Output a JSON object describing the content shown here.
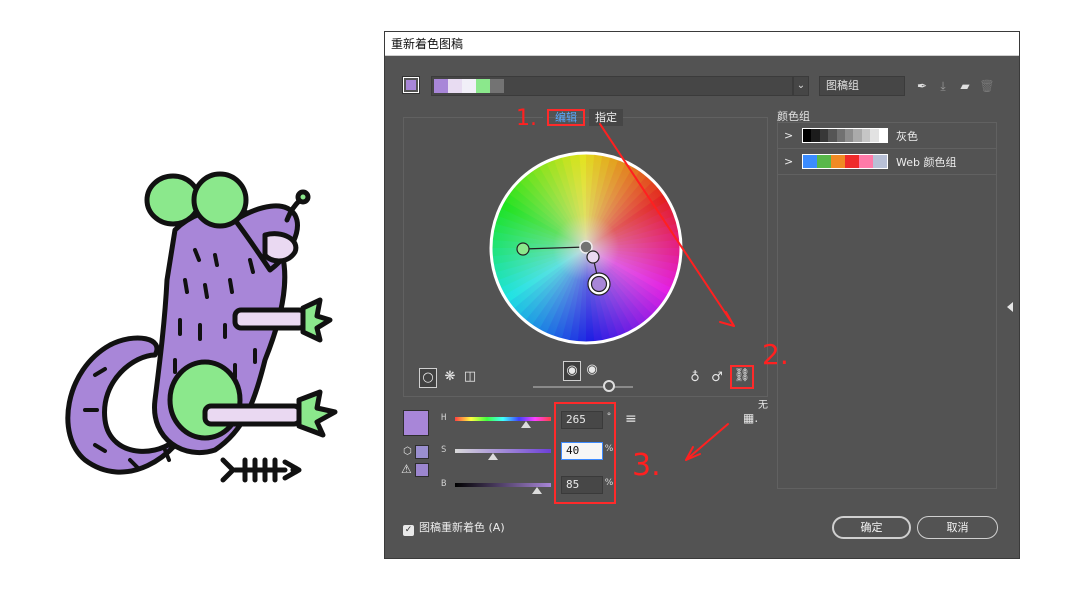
{
  "dialog": {
    "title": "重新着色图稿",
    "group_field": "图稿组",
    "current_color": "#a886d8",
    "strip_colors": [
      "#a886d8",
      "#e8dcf2",
      "#f1eff8",
      "#8be88c",
      "#737373"
    ],
    "tabs": {
      "edit": "编辑",
      "assign": "指定"
    },
    "color_groups_label": "颜色组",
    "groups": [
      {
        "label": "灰色",
        "colors": [
          "#000000",
          "#1c1c1c",
          "#383838",
          "#555555",
          "#717171",
          "#8d8d8d",
          "#aaaaaa",
          "#c6c6c6",
          "#e2e2e2",
          "#ffffff"
        ]
      },
      {
        "label": "Web 颜色组",
        "colors": [
          "#3b8cff",
          "#58b84a",
          "#f08a24",
          "#ef2b2b",
          "#ff7aa8",
          "#b8c0d6"
        ]
      }
    ],
    "hsb": {
      "h": {
        "label": "H",
        "value": "265",
        "unit": "°",
        "fraction": 0.74
      },
      "s": {
        "label": "S",
        "value": "40",
        "unit": "%",
        "fraction": 0.4
      },
      "b": {
        "label": "B",
        "value": "85",
        "unit": "%",
        "fraction": 0.85
      }
    },
    "none_label": "无",
    "recolor_label": "图稿重新着色 (A)",
    "ok_label": "确定",
    "cancel_label": "取消"
  },
  "annotations": {
    "one": "1.",
    "two": "2.",
    "three": "3."
  },
  "illustration": {
    "body_color": "#a886d8",
    "ear_color": "#8be88c",
    "accent_color": "#ead9f2"
  }
}
